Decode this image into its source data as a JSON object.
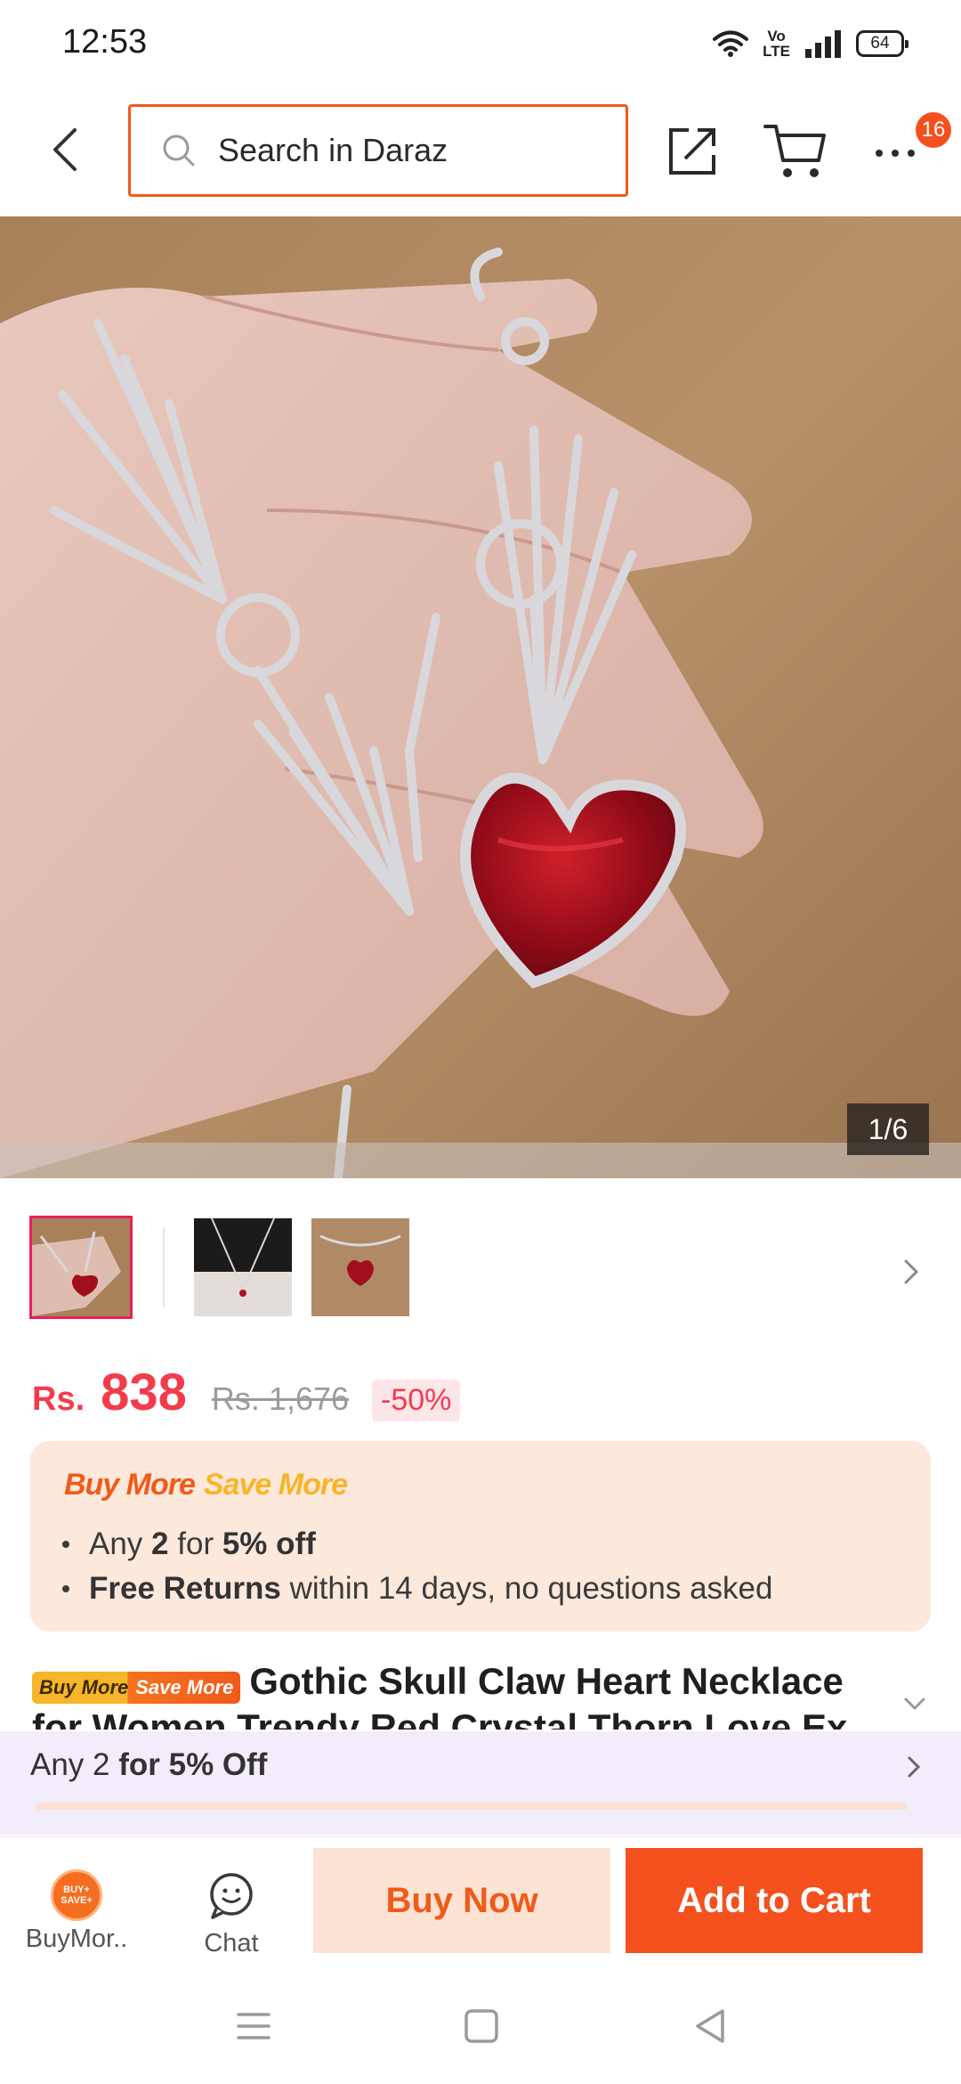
{
  "status_bar": {
    "time": "12:53",
    "volte_line1": "Vo",
    "volte_line2": "LTE",
    "battery": "64"
  },
  "header": {
    "back_icon": "chevron-left-icon",
    "search_placeholder": "Search in Daraz",
    "share_icon": "share-icon",
    "cart_icon": "cart-icon",
    "more_icon": "more-dots-icon",
    "more_badge": "16",
    "accent_color": "#f05a1a"
  },
  "gallery": {
    "counter": "1/6",
    "thumbnails": [
      {
        "name": "thumb-1",
        "active": true
      },
      {
        "name": "thumb-2",
        "active": false
      },
      {
        "name": "thumb-3",
        "active": false
      }
    ]
  },
  "price": {
    "currency": "Rs.",
    "amount": "838",
    "original": "Rs. 1,676",
    "discount": "-50%",
    "color": "#f33b4c"
  },
  "promo": {
    "title_buy_more": "Buy More",
    "title_save_more": "Save More",
    "line1_pre": "Any ",
    "line1_qty": "2",
    "line1_mid": " for ",
    "line1_off": "5% off",
    "line2_bold": "Free Returns",
    "line2_rest": " within 14 days, no questions asked"
  },
  "product": {
    "badge_buy_more": "Buy More",
    "badge_save_more": "Save More",
    "title": "Gothic Skull Claw Heart Necklace for Women Trendy Red Crystal Thorn Love Ex"
  },
  "offer_strip": {
    "pre": "Any 2 ",
    "bold": "for 5% Off"
  },
  "action_bar": {
    "buymore_label": "BuyMor..",
    "buymore_icon_text1": "BUY+",
    "buymore_icon_text2": "SAVE+",
    "chat_label": "Chat",
    "buy_now": "Buy Now",
    "add_to_cart": "Add to Cart"
  }
}
